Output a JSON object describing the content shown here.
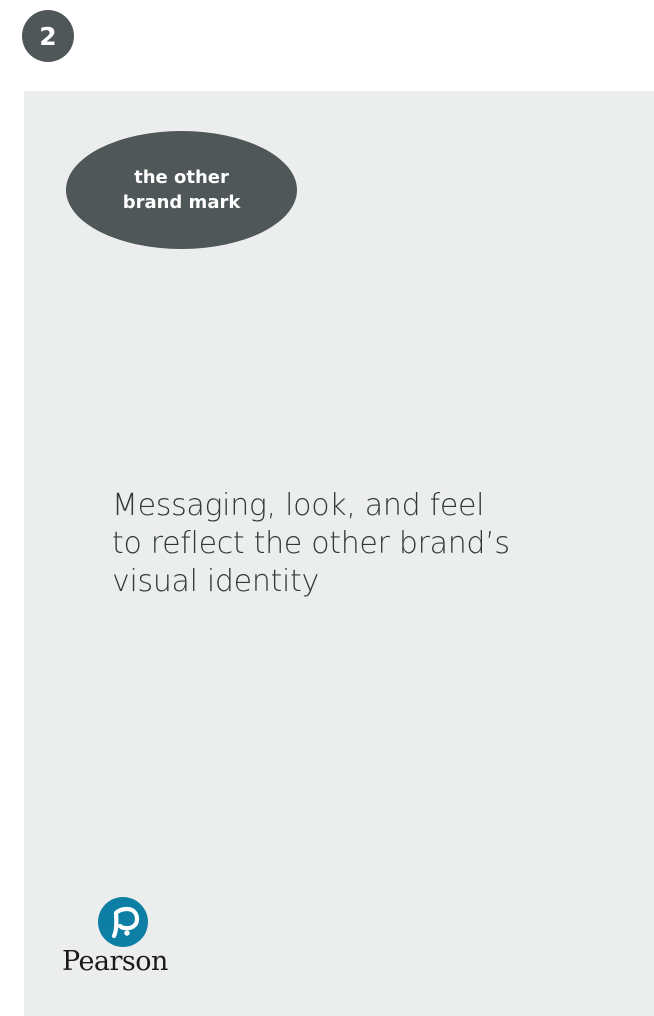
{
  "step": {
    "number": "2"
  },
  "brand_mark": {
    "text": "the other\nbrand mark"
  },
  "message": {
    "text": "Messaging, look, and feel\nto reflect the other brand’s\nvisual identity"
  },
  "logo": {
    "wordmark": "Pearson",
    "icon_name": "pearson-p-icon",
    "accent_color": "#0d7fa5"
  },
  "colors": {
    "badge": "#505759",
    "panel": "#eceded",
    "text": "#333738"
  }
}
